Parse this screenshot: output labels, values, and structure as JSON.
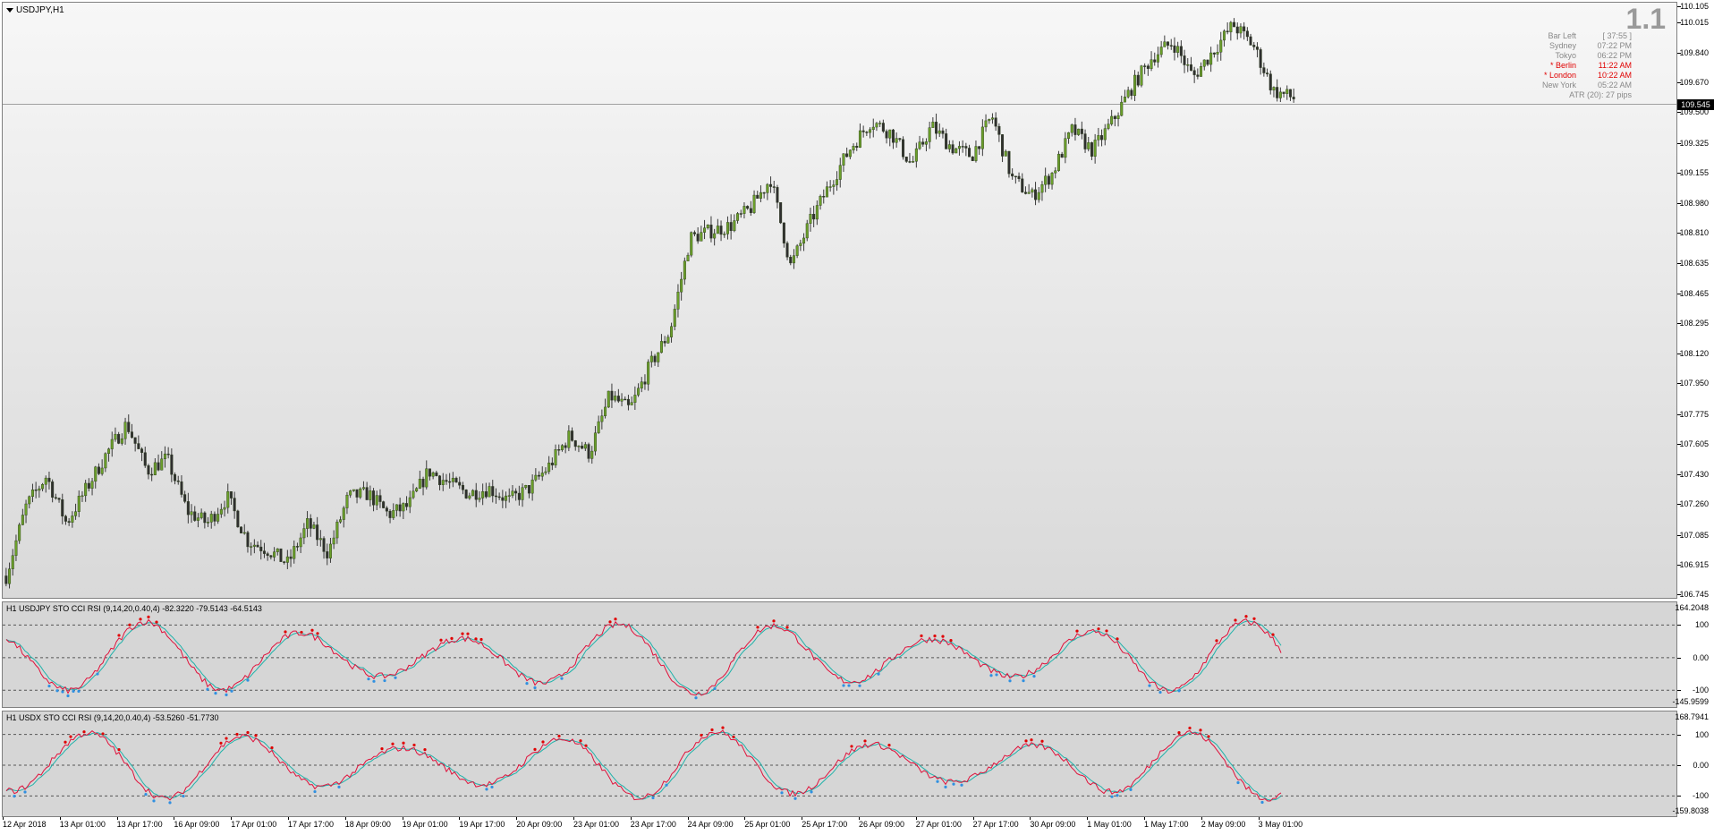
{
  "main": {
    "title": "USDJPY,H1",
    "big_number": "1.1",
    "bid_line_value": 109.545,
    "price_range": [
      106.745,
      110.105
    ],
    "price_labels": [
      "110.105",
      "110.015",
      "109.840",
      "109.670",
      "109.500",
      "109.325",
      "109.155",
      "108.980",
      "108.810",
      "108.635",
      "108.465",
      "108.295",
      "108.120",
      "107.950",
      "107.775",
      "107.605",
      "107.430",
      "107.260",
      "107.085",
      "106.915",
      "106.745"
    ],
    "current_price_label": "109.545",
    "info_panel": {
      "rows": [
        {
          "name": "Bar Left",
          "value": "[ 37:55 ]",
          "active": false
        },
        {
          "name": "Sydney",
          "value": "07:22 PM",
          "active": false
        },
        {
          "name": "Tokyo",
          "value": "06:22 PM",
          "active": false
        },
        {
          "name": "* Berlin",
          "value": "11:22 AM",
          "active": true
        },
        {
          "name": "* London",
          "value": "10:22 AM",
          "active": true
        },
        {
          "name": "New York",
          "value": "05:22 AM",
          "active": false
        }
      ],
      "atr": "ATR (20): 27 pips"
    },
    "colors": {
      "bull": "#6a9e2a",
      "bear": "#2f2f2f",
      "wick": "#3a3a3a",
      "bid_line": "#a0a0a0"
    }
  },
  "indicators": [
    {
      "title": "H1 USDJPY STO CCI RSI (9,14,20,0.40,4) -82.3220 -79.5143 -64.5143",
      "max_label": "164.2048",
      "min_label": "-145.9599",
      "range": [
        -145.9599,
        164.2048
      ],
      "levels": [
        "100",
        "0.00",
        "-100"
      ],
      "level_values": [
        100,
        0,
        -100
      ]
    },
    {
      "title": "H1 USDX STO CCI RSI (9,14,20,0.40,4) -53.5260 -51.7730",
      "max_label": "168.7941",
      "min_label": "-159.8038",
      "range": [
        -159.8038,
        168.7941
      ],
      "levels": [
        "100",
        "0.00",
        "-100"
      ],
      "level_values": [
        100,
        0,
        -100
      ]
    }
  ],
  "indicator_colors": {
    "fast": "#e0103a",
    "slow": "#20b2aa",
    "dot_up": "#e00000",
    "dot_down": "#3090e0",
    "level": "#555555"
  },
  "time_labels": [
    "12 Apr 2018",
    "13 Apr 01:00",
    "13 Apr 17:00",
    "16 Apr 09:00",
    "17 Apr 01:00",
    "17 Apr 17:00",
    "18 Apr 09:00",
    "19 Apr 01:00",
    "19 Apr 17:00",
    "20 Apr 09:00",
    "23 Apr 01:00",
    "23 Apr 17:00",
    "24 Apr 09:00",
    "25 Apr 01:00",
    "25 Apr 17:00",
    "26 Apr 09:00",
    "27 Apr 01:00",
    "27 Apr 17:00",
    "30 Apr 09:00",
    "1 May 01:00",
    "1 May 17:00",
    "2 May 09:00",
    "3 May 01:00"
  ],
  "chart_data": {
    "type": "candlestick",
    "title": "USDJPY,H1",
    "ylim": [
      106.745,
      110.105
    ],
    "close_path": [
      106.85,
      107.25,
      107.42,
      107.15,
      107.35,
      107.55,
      107.72,
      107.45,
      107.52,
      107.22,
      107.15,
      107.3,
      107.05,
      107.0,
      106.92,
      107.15,
      106.98,
      107.3,
      107.32,
      107.2,
      107.25,
      107.45,
      107.38,
      107.32,
      107.35,
      107.28,
      107.35,
      107.48,
      107.65,
      107.55,
      107.88,
      107.8,
      108.05,
      108.25,
      108.78,
      108.82,
      108.85,
      108.95,
      109.12,
      108.62,
      108.88,
      109.1,
      109.3,
      109.45,
      109.38,
      109.2,
      109.42,
      109.3,
      109.25,
      109.48,
      109.12,
      109.02,
      109.15,
      109.4,
      109.28,
      109.45,
      109.65,
      109.82,
      109.9,
      109.7,
      109.85,
      110.0,
      109.88,
      109.62,
      109.58
    ]
  }
}
